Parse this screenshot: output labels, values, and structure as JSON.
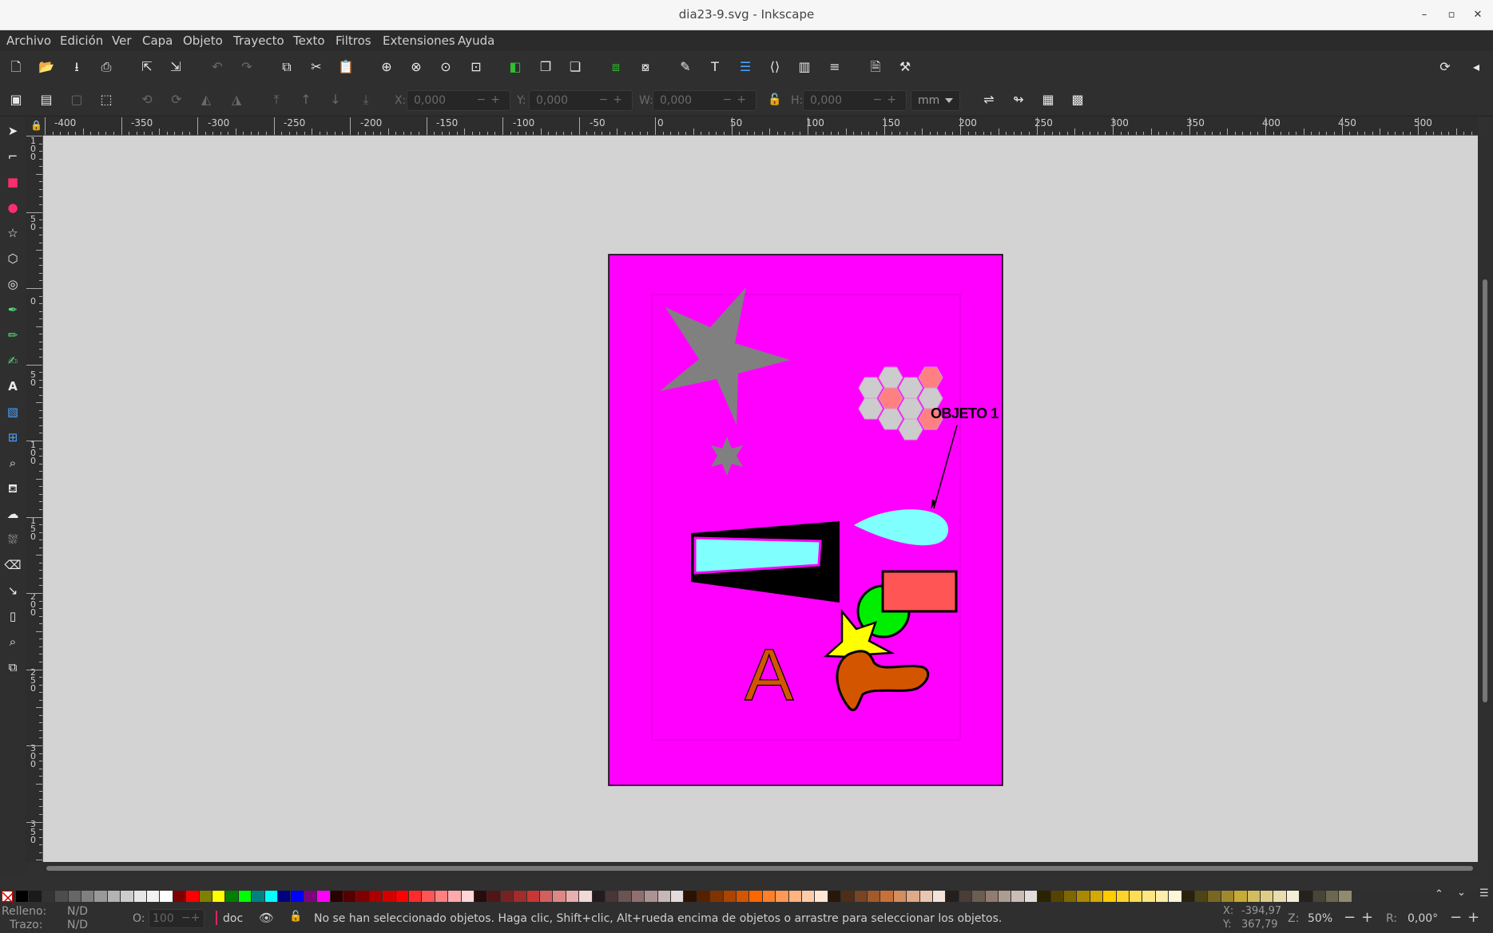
{
  "window": {
    "title": "dia23-9.svg - Inkscape",
    "controls": [
      "–",
      "▫",
      "✕"
    ]
  },
  "menu": [
    "Archivo",
    "Edición",
    "Ver",
    "Capa",
    "Objeto",
    "Trayecto",
    "Texto",
    "Filtros",
    "Extensiones",
    "Ayuda"
  ],
  "command_bar": {
    "icons": [
      "new-document-icon",
      "open-icon",
      "save-icon",
      "print-icon",
      "import-icon",
      "export-icon",
      "undo-icon",
      "redo-icon",
      "copy-icon",
      "cut-icon",
      "paste-icon",
      "zoom-selection-icon",
      "zoom-drawing-icon",
      "zoom-page-icon",
      "zoom-page-width-icon",
      "duplicate-icon",
      "clone-icon",
      "unlink-clone-icon",
      "group-icon",
      "ungroup-icon",
      "xml-editor-icon",
      "text-font-icon",
      "layers-icon",
      "xml-icon",
      "objects-icon",
      "align-icon",
      "document-properties-icon",
      "preferences-icon",
      "snap-icon",
      "expand-icon"
    ]
  },
  "controls": {
    "x_label": "X:",
    "x_value": "0,000",
    "y_label": "Y:",
    "y_value": "0,000",
    "w_label": "W:",
    "w_value": "0,000",
    "h_label": "H:",
    "h_value": "0,000",
    "unit": "mm"
  },
  "ruler": {
    "h_labels": [
      "-400",
      "-350",
      "-300",
      "-250",
      "-200",
      "-150",
      "-100",
      "-50",
      "0",
      "50",
      "100",
      "150",
      "200",
      "250",
      "300",
      "350",
      "400",
      "450",
      "500"
    ],
    "v_labels": [
      "1 0 0",
      "5 0",
      "0",
      "5 0",
      "1 0 0",
      "1 5 0",
      "2 0 0",
      "2 5 0",
      "3 0 0",
      "3 5 0"
    ]
  },
  "drawing": {
    "annotation": "OBJETO 1",
    "letter": "A",
    "page_color": "#ff00ff",
    "accent_colors": {
      "star": "#808080",
      "cyan": "#80ffff",
      "red_rect": "#ff5555",
      "green": "#00ee00",
      "yellow": "#ffff00",
      "orange": "#d45500",
      "hex_grey": "#cccccc",
      "hex_pink": "#ff8080"
    }
  },
  "palette": {
    "swatches": [
      "#000000",
      "#1a1a1a",
      "#333333",
      "#4d4d4d",
      "#666666",
      "#808080",
      "#999999",
      "#b3b3b3",
      "#cccccc",
      "#e6e6e6",
      "#f2f2f2",
      "#ffffff",
      "#800000",
      "#ff0000",
      "#808000",
      "#ffff00",
      "#008000",
      "#00ff00",
      "#008080",
      "#00ffff",
      "#000080",
      "#0000ff",
      "#800080",
      "#ff00ff",
      "#2b0000",
      "#550000",
      "#800000",
      "#aa0000",
      "#d40000",
      "#ff0000",
      "#ff2a2a",
      "#ff5555",
      "#ff8080",
      "#ffaaaa",
      "#ffd5d5",
      "#280b0b",
      "#501616",
      "#782121",
      "#a02c2c",
      "#c83737",
      "#d35f5f",
      "#de8787",
      "#e9afaf",
      "#f4d7d7",
      "#241c1c",
      "#483737",
      "#6c5353",
      "#916f6f",
      "#ac9393",
      "#c8b7b7",
      "#e3dbdb",
      "#2b1100",
      "#552200",
      "#803300",
      "#aa4400",
      "#d45500",
      "#ff6600",
      "#ff7f2a",
      "#ff9955",
      "#ffb380",
      "#ffccaa",
      "#ffe6d5",
      "#28170b",
      "#502d16",
      "#784421",
      "#a05a2c",
      "#c87137",
      "#d38d5f",
      "#deaa87",
      "#e9c6af",
      "#f4e3d7",
      "#241f1c",
      "#483e37",
      "#6c5d53",
      "#917c6f",
      "#ac9d93",
      "#c8beb7",
      "#e3dedb",
      "#2b2200",
      "#554400",
      "#806600",
      "#aa8800",
      "#d4aa00",
      "#ffcc00",
      "#ffd42a",
      "#ffdd55",
      "#ffe680",
      "#ffeeaa",
      "#fff6d5",
      "#28220b",
      "#504416",
      "#786721",
      "#a0892c",
      "#c8ab37",
      "#d3bc5f",
      "#decd87",
      "#e9ddaf",
      "#f4eed7",
      "#24221c",
      "#484537",
      "#6c6753",
      "#918a6f"
    ]
  },
  "status": {
    "fill_label": "Relleno:",
    "fill_value": "N/D",
    "stroke_label": "Trazo:",
    "stroke_value": "N/D",
    "opacity_label": "O:",
    "opacity_value": "100",
    "layer": "doc",
    "message": "No se han seleccionado objetos. Haga clic, Shift+clic, Alt+rueda encima de objetos o arrastre para seleccionar los objetos.",
    "x_label": "X:",
    "x_value": "-394,97",
    "y_label": "Y:",
    "y_value": "367,79",
    "zoom_label": "Z:",
    "zoom_value": "50%",
    "rotation_label": "R:",
    "rotation_value": "0,00°"
  }
}
